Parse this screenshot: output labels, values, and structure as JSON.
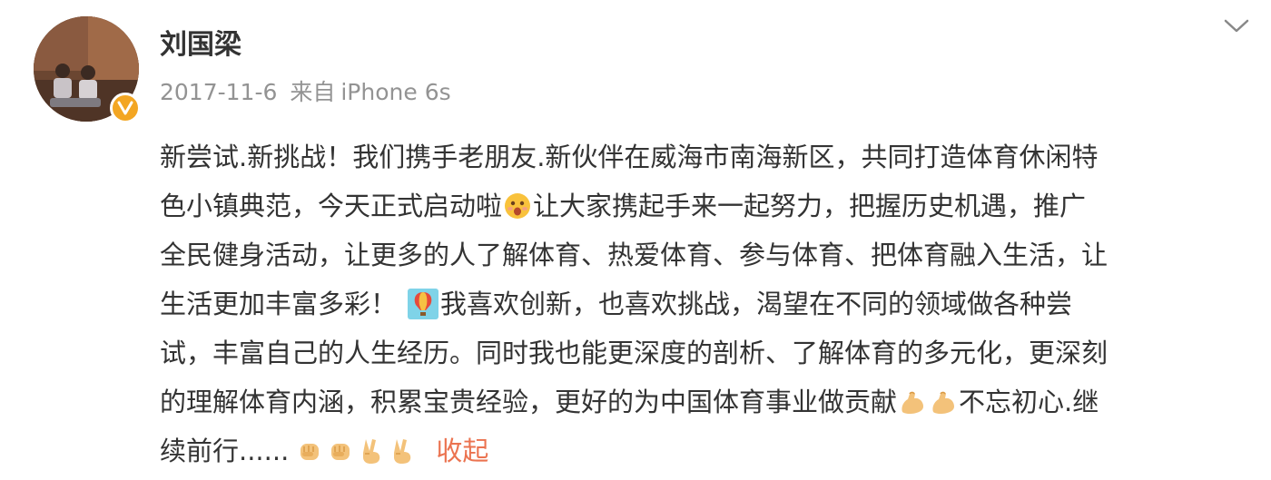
{
  "post": {
    "author": {
      "name": "刘国梁",
      "avatar_icon": "user-avatar-photo",
      "verified_badge_icon": "verified-v-icon",
      "verified_color": "#f3a623"
    },
    "date": "2017-11-6",
    "source_prefix": "来自",
    "source_device": "iPhone 6s",
    "more_icon": "chevron-down-icon",
    "text": {
      "line1": "新尝试.新挑战！我们携手老朋友.新伙伴在威海市南海新区，共同打造体育休闲特",
      "line2_a": "色小镇典范，今天正式启动啦",
      "line2_b": "让大家携起手来一起努力，把握历史机遇，推广",
      "line3": "全民健身活动，让更多的人了解体育、热爱体育、参与体育、把体育融入生活，让",
      "line4_a": "生活更加丰富多彩！",
      "line4_b": "我喜欢创新，也喜欢挑战，渴望在不同的领域做各种尝",
      "line5": "试，丰富自己的人生经历。同时我也能更深度的剖析、了解体育的多元化，更深刻",
      "line6_a": "的理解体育内涵，积累宝贵经验，更好的为中国体育事业做贡献",
      "line6_b": "不忘初心.继",
      "line7_a": "续前行......"
    },
    "emojis": {
      "excited": "excited-face-emoji",
      "balloon": "hot-air-balloon-emoji",
      "muscle": "flexed-biceps-emoji",
      "fist": "raised-fist-emoji",
      "victory": "victory-hand-emoji"
    },
    "collapse_label": "收起",
    "link_color": "#eb7350"
  }
}
